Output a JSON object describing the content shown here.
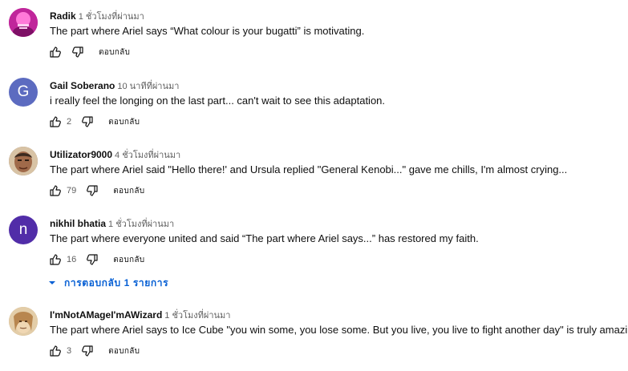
{
  "reply_label": "ตอบกลับ",
  "comments": [
    {
      "author": "Radik",
      "time": "1 ชั่วโมงที่ผ่านมา",
      "text": "The part where Ariel says “What colour is your bugatti” is motivating.",
      "likes": "",
      "avatar": {
        "type": "image",
        "icon": "pink-avatar-icon",
        "bg": "#c0269b"
      }
    },
    {
      "author": "Gail Soberano",
      "time": "10 นาทีที่ผ่านมา",
      "text": "i really feel the longing on the last part... can't wait to see this adaptation.",
      "likes": "2",
      "avatar": {
        "type": "letter",
        "letter": "G",
        "bg": "#5c6bc0"
      }
    },
    {
      "author": "Utilizator9000",
      "time": "4 ชั่วโมงที่ผ่านมา",
      "text": "The part where Ariel said \"Hello there!' and Ursula replied \"General Kenobi...\" gave me chills, I'm almost crying...",
      "likes": "79",
      "avatar": {
        "type": "image",
        "icon": "face-photo-icon",
        "bg": "#8d6e5a"
      }
    },
    {
      "author": "nikhil bhatia",
      "time": "1 ชั่วโมงที่ผ่านมา",
      "text": "The part where everyone united and said “The part where Ariel says...” has restored my faith.",
      "likes": "16",
      "avatar": {
        "type": "letter",
        "letter": "n",
        "bg": "#512da8"
      }
    },
    {
      "author": "I'mNotAMageI'mAWizard",
      "time": "1 ชั่วโมงที่ผ่านมา",
      "text": "The part where Ariel says to Ice Cube \"you win some, you lose some. But you live, you live to fight another day\" is truly amazing.",
      "likes": "3",
      "avatar": {
        "type": "image",
        "icon": "wizard-photo-icon",
        "bg": "#c7a57c"
      }
    }
  ],
  "replies_toggle": {
    "label": "การตอบกลับ 1 รายการ"
  },
  "colors": {
    "link": "#065fd4",
    "secondary_text": "#606060"
  }
}
